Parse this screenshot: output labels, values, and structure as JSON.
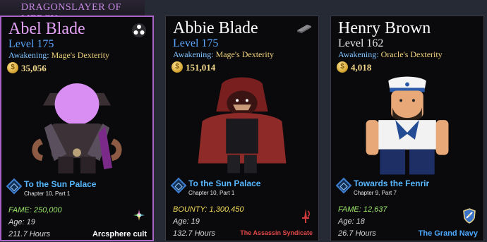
{
  "banner": {
    "title": "DRAGONSLAYER OF MERCY"
  },
  "cards": [
    {
      "name": "Abel Blade",
      "level": "Level 175",
      "awakening_label": "Awakening:",
      "awakening": "Mage's Dexterity",
      "gold": "35,056",
      "quest": "To the Sun Palace",
      "chapter": "Chapter 10, Part 1",
      "stat1": "FAME: 250,000",
      "age": "Age: 19",
      "hours": "211.7 Hours",
      "faction": "Arcsphere cult",
      "corner_icon": "triple-orb-icon",
      "emblem_icon": "arcsphere-emblem-icon"
    },
    {
      "name": "Abbie Blade",
      "level": "Level 175",
      "awakening_label": "Awakening:",
      "awakening": "Mage's Dexterity",
      "gold": "151,014",
      "quest": "To the Sun Palace",
      "chapter": "Chapter 10, Part 1",
      "stat1": "BOUNTY: 1,300,450",
      "age": "Age: 19",
      "hours": "132.7 Hours",
      "faction": "The Assassin Syndicate",
      "corner_icon": "ingot-icon",
      "emblem_icon": "assassin-dagger-icon"
    },
    {
      "name": "Henry Brown",
      "level": "Level 162",
      "awakening_label": "Awakening:",
      "awakening": "Oracle's Dexterity",
      "gold": "4,018",
      "quest": "Towards the Fenrir",
      "chapter": "Chapter 9, Part 7",
      "stat1": "FAME: 12,637",
      "age": "Age: 18",
      "hours": "26.7 Hours",
      "faction": "The Grand Navy",
      "corner_icon": "",
      "emblem_icon": "navy-shield-icon"
    }
  ],
  "colors": {
    "accent_purple": "#a864c9",
    "level_blue": "#5aa7ff",
    "fame_green": "#9be66b",
    "bounty_yellow": "#f4dc5a",
    "syndicate_red": "#e24747",
    "navy_blue": "#4ca9ff"
  }
}
